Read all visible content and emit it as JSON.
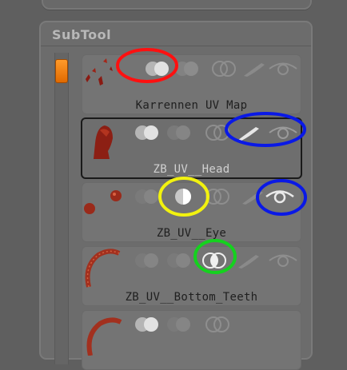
{
  "panel": {
    "title": "SubTool"
  },
  "subtools": [
    {
      "name": "Karrennen UV Map",
      "selected": false,
      "thumbnail": "red-fragments",
      "solo_state": "on"
    },
    {
      "name": "ZB_UV__Head",
      "selected": true,
      "thumbnail": "red-head",
      "solo_state": "on"
    },
    {
      "name": "ZB_UV__Eye",
      "selected": false,
      "thumbnail": "red-eyes",
      "solo_state": "half"
    },
    {
      "name": "ZB_UV__Bottom_Teeth",
      "selected": false,
      "thumbnail": "red-teeth",
      "solo_state": "off"
    },
    {
      "name": "",
      "selected": false,
      "thumbnail": "red-teeth",
      "solo_state": "on"
    }
  ],
  "icons": {
    "visibility_toggle": "visibility-toggle-icon",
    "display_toggle": "display-toggle-icon",
    "polypaint": "polypaint-brush-icon",
    "eye": "eye-icon"
  },
  "colors": {
    "scroll_thumb": "#f57f00",
    "annotation_red": "#ff1010",
    "annotation_blue": "#0a19e6",
    "annotation_yellow": "#f2f20f",
    "annotation_green": "#14d21e"
  }
}
